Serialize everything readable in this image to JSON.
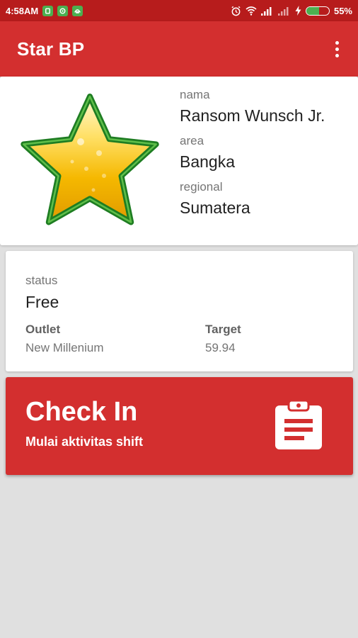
{
  "status_bar": {
    "time": "4:58AM",
    "notification_icons": [
      "notification-app-icon-1",
      "notification-app-icon-2",
      "notification-app-icon-3"
    ],
    "icons": [
      "alarm-icon",
      "wifi-icon",
      "signal-icon",
      "signal-icon-2",
      "charging-icon",
      "battery-icon"
    ],
    "battery_percent": "55%",
    "battery_level": 0.55
  },
  "app_bar": {
    "title": "Star BP",
    "menu_icon": "overflow-menu-icon"
  },
  "profile": {
    "logo_icon": "star-logo-icon",
    "nama_label": "nama",
    "nama_value": "Ransom Wunsch Jr.",
    "area_label": "area",
    "area_value": "Bangka",
    "regional_label": "regional",
    "regional_value": "Sumatera"
  },
  "status_card": {
    "status_label": "status",
    "status_value": "Free",
    "outlet_label": "Outlet",
    "outlet_value": "New Millenium",
    "target_label": "Target",
    "target_value": "59.94"
  },
  "checkin": {
    "title": "Check In",
    "subtitle": "Mulai aktivitas shift",
    "icon": "clipboard-icon"
  },
  "colors": {
    "primary": "#d32f2f",
    "status_bar": "#b71c1c",
    "background": "#e0e0e0",
    "battery_fill": "#4caf50"
  }
}
